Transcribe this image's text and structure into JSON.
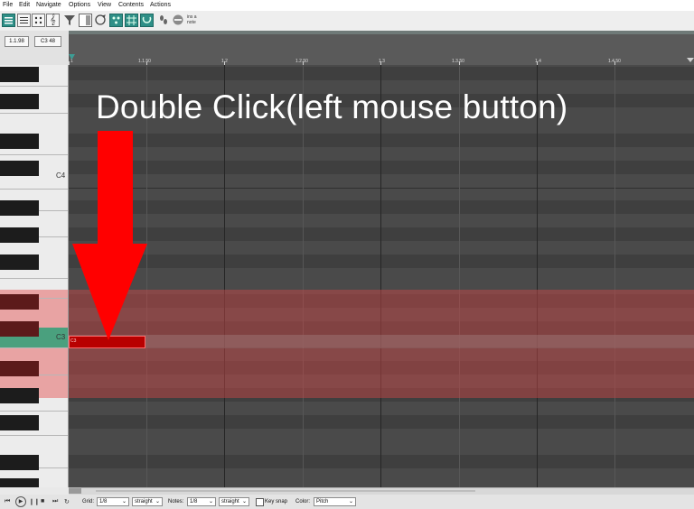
{
  "menu": {
    "items": [
      "File",
      "Edit",
      "Navigate",
      "Options",
      "View",
      "Contents",
      "Actions"
    ]
  },
  "toolbar": {
    "icons": [
      "piano-roll-view-icon",
      "named-notes-icon",
      "drum-view-icon",
      "treble-clef-icon",
      "filter-icon",
      "list-view-icon",
      "loop-icon",
      "note-color-icon",
      "grid-icon",
      "snap-icon",
      "step-input-icon",
      "midi-input-icon",
      "volume-icon"
    ],
    "insert_label": "ins a\nnote"
  },
  "position": {
    "time": "1.1.98",
    "note": "C3 48"
  },
  "ruler": {
    "labels": [
      "1",
      "1.1.50",
      "1.2",
      "1.2.50",
      "1.3",
      "1.3.50",
      "1.4",
      "1.4.50"
    ]
  },
  "piano": {
    "labels": [
      "C4",
      "C3"
    ]
  },
  "note": {
    "label": "C3"
  },
  "overlay": {
    "instruction": "Double Click(left mouse button)",
    "arrow_color": "#ff0000"
  },
  "bottom": {
    "grid_label": "Grid:",
    "grid_value": "1/8",
    "grid_mode": "straight",
    "notes_label": "Notes:",
    "notes_value": "1/8",
    "notes_mode": "straight",
    "keysnap_label": "Key snap",
    "color_label": "Color:",
    "color_value": "Pitch"
  },
  "colors": {
    "grid_bg": "#4a4a4a",
    "selection": "#c44646",
    "note": "#b80000",
    "c3_key": "#4aa07e"
  }
}
